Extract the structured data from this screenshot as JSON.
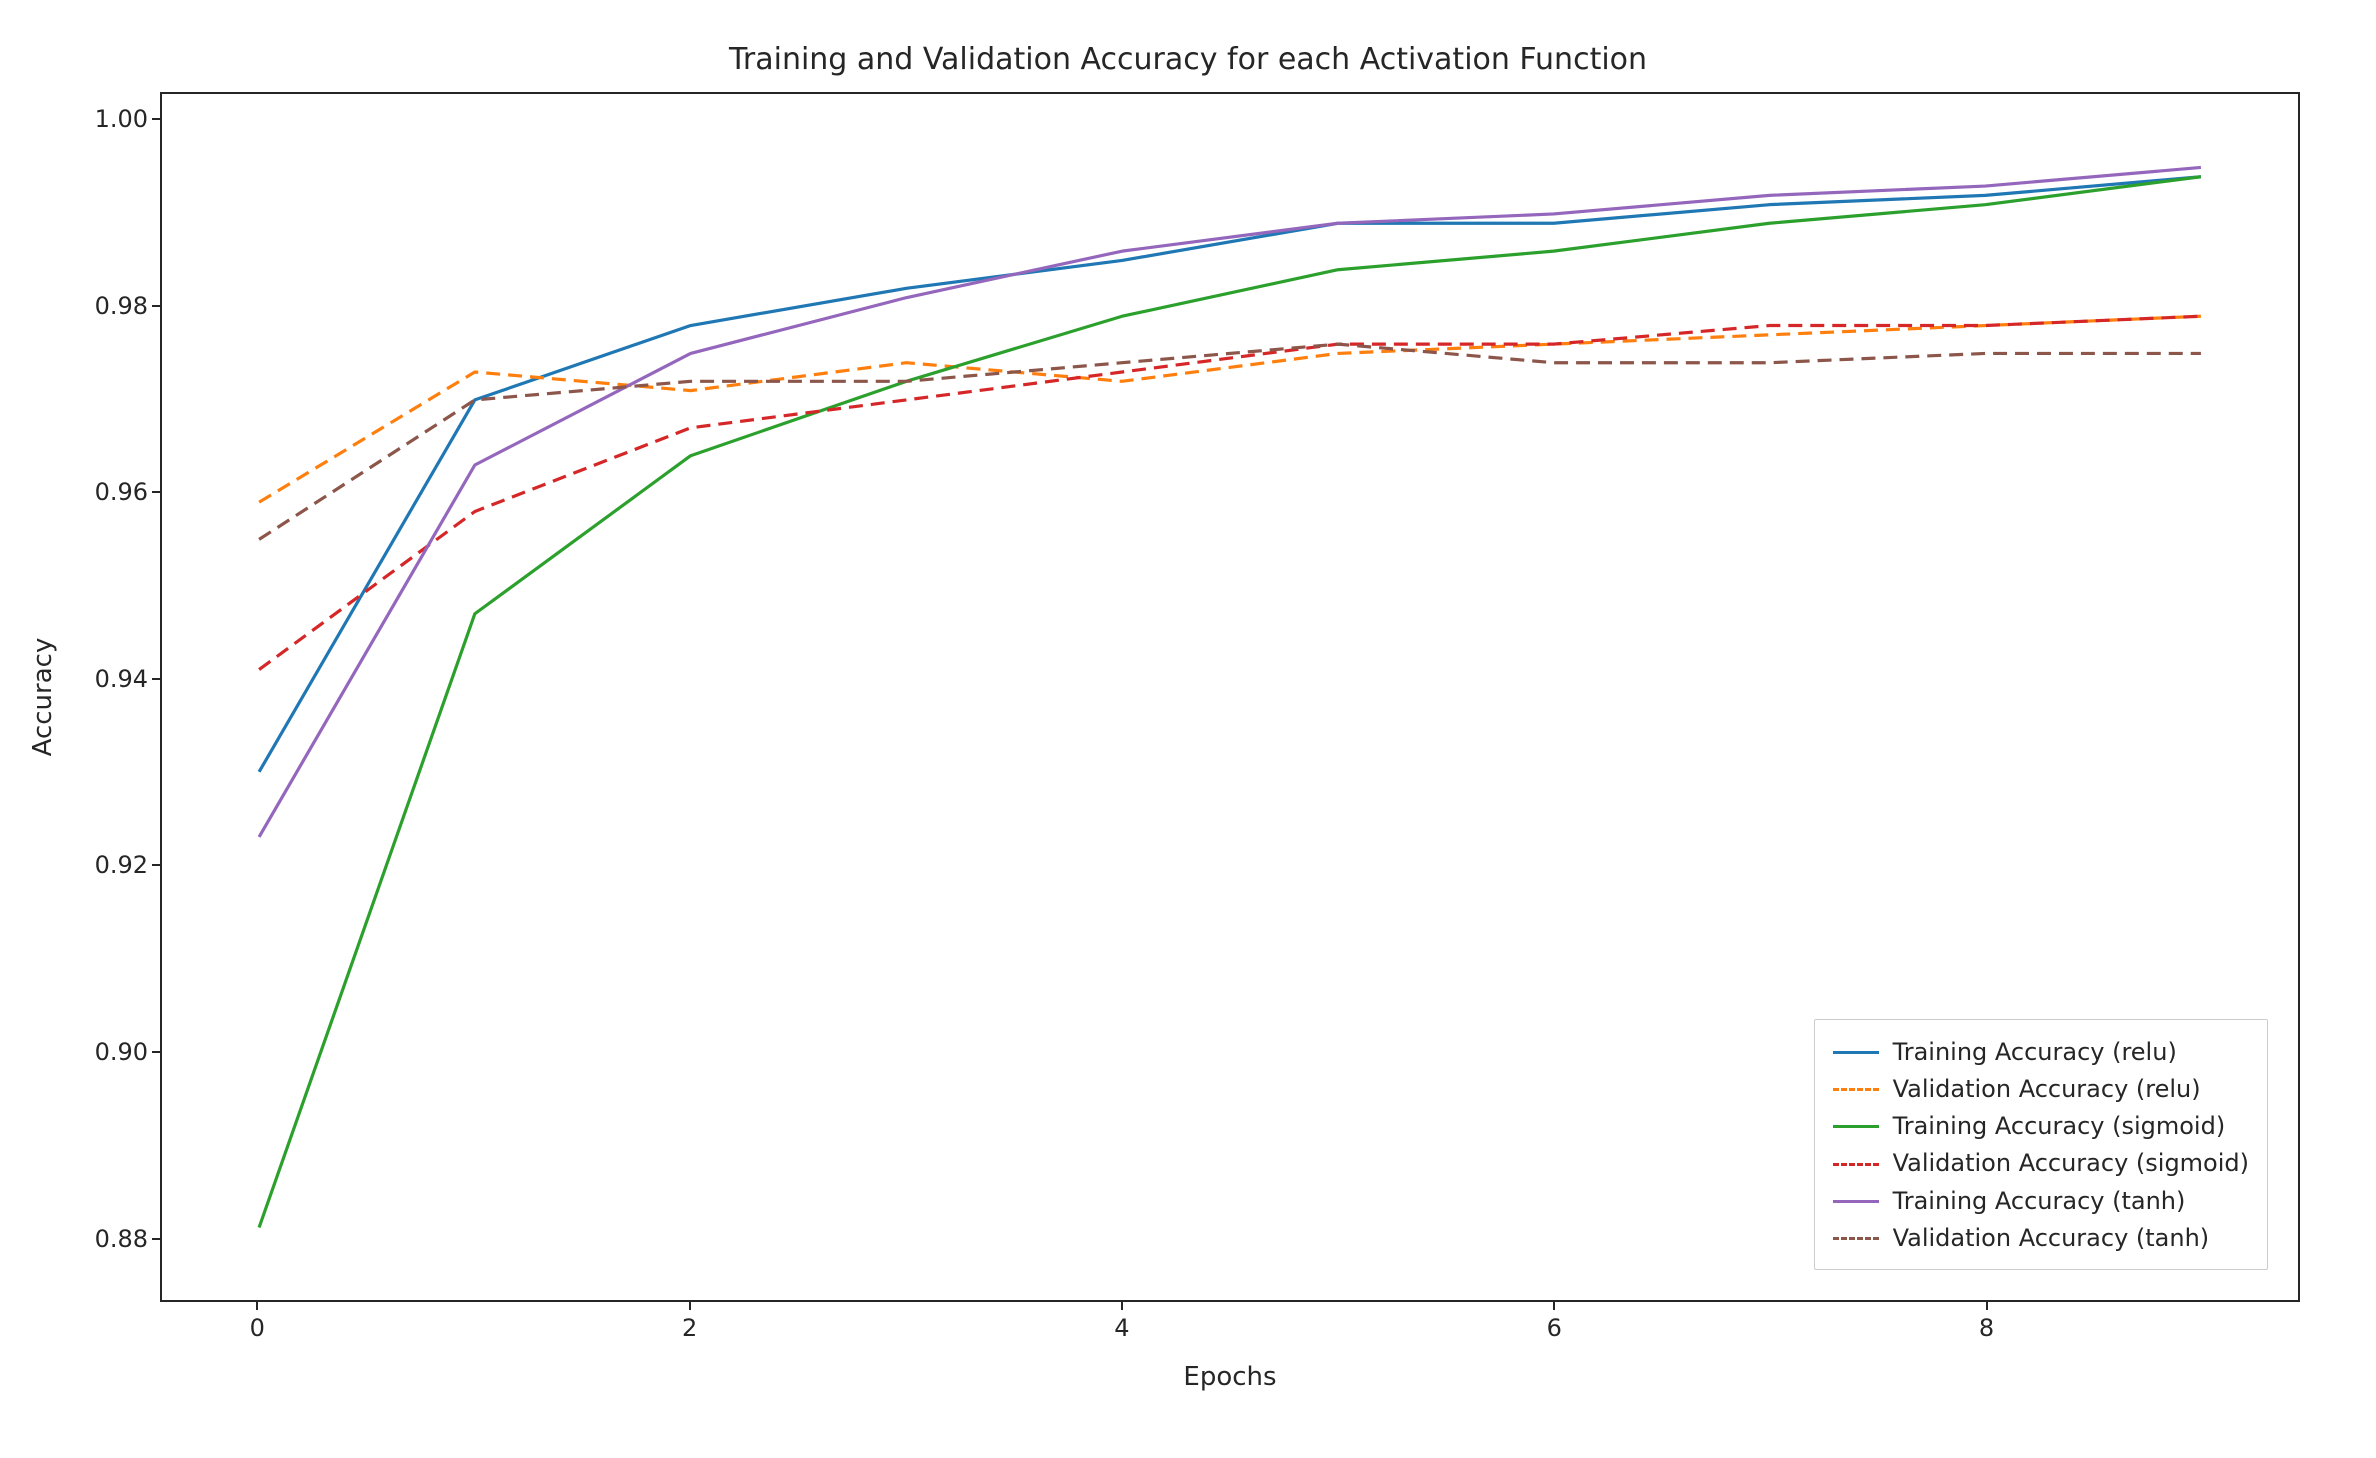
{
  "chart_data": {
    "type": "line",
    "title": "Training and Validation Accuracy for each Activation Function",
    "xlabel": "Epochs",
    "ylabel": "Accuracy",
    "x": [
      0,
      1,
      2,
      3,
      4,
      5,
      6,
      7,
      8,
      9
    ],
    "xlim": [
      -0.45,
      9.45
    ],
    "ylim": [
      0.8732,
      1.0029
    ],
    "xticks": [
      0,
      2,
      4,
      6,
      8
    ],
    "yticks": [
      0.88,
      0.9,
      0.92,
      0.94,
      0.96,
      0.98,
      1.0
    ],
    "series": [
      {
        "name": "Training Accuracy (relu)",
        "color": "#1f77b4",
        "style": "solid",
        "values": [
          0.93,
          0.97,
          0.978,
          0.982,
          0.985,
          0.989,
          0.989,
          0.991,
          0.992,
          0.994
        ]
      },
      {
        "name": "Validation Accuracy (relu)",
        "color": "#ff7f0e",
        "style": "dashed",
        "values": [
          0.959,
          0.973,
          0.971,
          0.974,
          0.972,
          0.975,
          0.976,
          0.977,
          0.978,
          0.979
        ]
      },
      {
        "name": "Training Accuracy (sigmoid)",
        "color": "#2ca02c",
        "style": "solid",
        "values": [
          0.881,
          0.947,
          0.964,
          0.972,
          0.979,
          0.984,
          0.986,
          0.989,
          0.991,
          0.994
        ]
      },
      {
        "name": "Validation Accuracy (sigmoid)",
        "color": "#d62728",
        "style": "dashed",
        "values": [
          0.941,
          0.958,
          0.967,
          0.97,
          0.973,
          0.976,
          0.976,
          0.978,
          0.978,
          0.979
        ]
      },
      {
        "name": "Training Accuracy (tanh)",
        "color": "#9467bd",
        "style": "solid",
        "values": [
          0.923,
          0.963,
          0.975,
          0.981,
          0.986,
          0.989,
          0.99,
          0.992,
          0.993,
          0.995
        ]
      },
      {
        "name": "Validation Accuracy (tanh)",
        "color": "#8c564b",
        "style": "dashed",
        "values": [
          0.955,
          0.97,
          0.972,
          0.972,
          0.974,
          0.976,
          0.974,
          0.974,
          0.975,
          0.975
        ]
      }
    ]
  }
}
